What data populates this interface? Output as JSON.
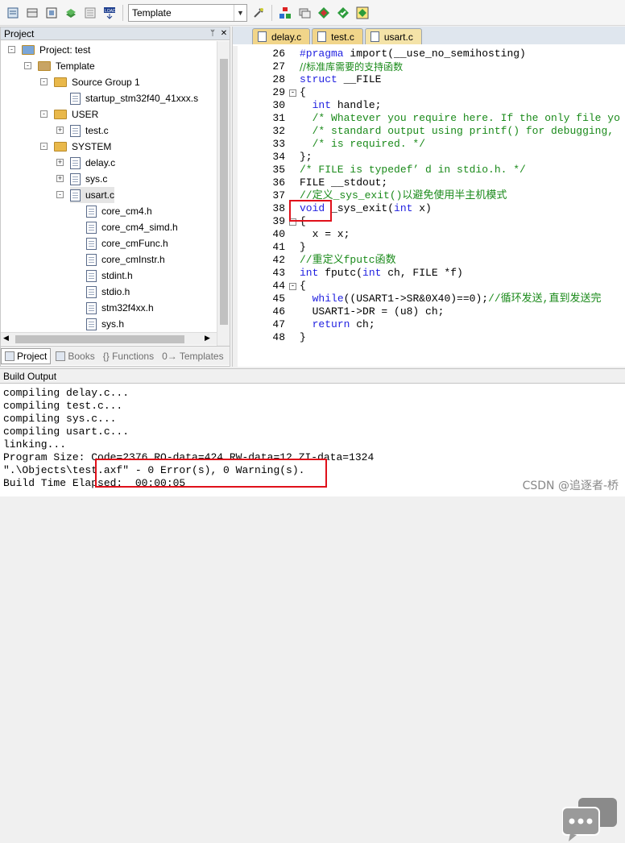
{
  "toolbar": {
    "target_name": "Template",
    "icons": [
      "settings-icon",
      "pack-icon",
      "build-icon",
      "books-icon",
      "download-icon",
      "load-icon",
      "options-icon",
      "run-icon",
      "debug-icon",
      "components-icon",
      "batch-icon",
      "manage-icon"
    ]
  },
  "project_panel": {
    "title": "Project",
    "pin": "p",
    "close": "x",
    "tree": [
      {
        "label": "Project: test",
        "level": 0,
        "kind": "project",
        "expander": "-"
      },
      {
        "label": "Template",
        "level": 1,
        "kind": "target",
        "expander": "-"
      },
      {
        "label": "Source Group 1",
        "level": 2,
        "kind": "folder",
        "expander": "-"
      },
      {
        "label": "startup_stm32f40_41xxx.s",
        "level": 3,
        "kind": "file",
        "expander": ""
      },
      {
        "label": "USER",
        "level": 2,
        "kind": "folder",
        "expander": "-"
      },
      {
        "label": "test.c",
        "level": 3,
        "kind": "file",
        "expander": "+"
      },
      {
        "label": "SYSTEM",
        "level": 2,
        "kind": "folder",
        "expander": "-"
      },
      {
        "label": "delay.c",
        "level": 3,
        "kind": "file",
        "expander": "+"
      },
      {
        "label": "sys.c",
        "level": 3,
        "kind": "file",
        "expander": "+"
      },
      {
        "label": "usart.c",
        "level": 3,
        "kind": "file",
        "expander": "-",
        "selected": true
      },
      {
        "label": "core_cm4.h",
        "level": 4,
        "kind": "file",
        "expander": ""
      },
      {
        "label": "core_cm4_simd.h",
        "level": 4,
        "kind": "file",
        "expander": ""
      },
      {
        "label": "core_cmFunc.h",
        "level": 4,
        "kind": "file",
        "expander": ""
      },
      {
        "label": "core_cmInstr.h",
        "level": 4,
        "kind": "file",
        "expander": ""
      },
      {
        "label": "stdint.h",
        "level": 4,
        "kind": "file",
        "expander": ""
      },
      {
        "label": "stdio.h",
        "level": 4,
        "kind": "file",
        "expander": ""
      },
      {
        "label": "stm32f4xx.h",
        "level": 4,
        "kind": "file",
        "expander": ""
      },
      {
        "label": "sys.h",
        "level": 4,
        "kind": "file",
        "expander": ""
      }
    ],
    "tabs": [
      {
        "label": "Project",
        "active": true
      },
      {
        "label": "Books",
        "active": false
      },
      {
        "label": "{} Functions",
        "active": false
      },
      {
        "label": "0→ Templates",
        "active": false
      }
    ]
  },
  "editor": {
    "tabs": [
      {
        "label": "delay.c",
        "active": false
      },
      {
        "label": "test.c",
        "active": false
      },
      {
        "label": "usart.c",
        "active": true
      }
    ],
    "lines": [
      {
        "n": "26",
        "fold": "",
        "html": "<span class='kw'>#pragma</span> import(__use_no_semihosting)"
      },
      {
        "n": "27",
        "fold": "",
        "html": "<span class='cm zh'>//标准库需要的支持函数</span>"
      },
      {
        "n": "28",
        "fold": "",
        "html": "<span class='kw'>struct</span> __FILE"
      },
      {
        "n": "29",
        "fold": "-",
        "html": "{"
      },
      {
        "n": "30",
        "fold": "",
        "html": "  <span class='kw'>int</span> handle;"
      },
      {
        "n": "31",
        "fold": "",
        "html": "  <span class='cm'>/* Whatever you require here. If the only file yo</span>"
      },
      {
        "n": "32",
        "fold": "",
        "html": "  <span class='cm'>/* standard output using printf() for debugging,</span>"
      },
      {
        "n": "33",
        "fold": "",
        "html": "  <span class='cm'>/* is required. */</span>"
      },
      {
        "n": "34",
        "fold": "",
        "html": "};"
      },
      {
        "n": "35",
        "fold": "",
        "html": "<span class='cm'>/* FILE is typedef’ d in stdio.h. */</span>"
      },
      {
        "n": "36",
        "fold": "",
        "html": "FILE __stdout;"
      },
      {
        "n": "37",
        "fold": "",
        "html": "<span class='cm'>//定义_sys_exit()以避免使用半主机模式</span>"
      },
      {
        "n": "38",
        "fold": "",
        "html": "<span class='kw'>void</span> _sys_exit(<span class='kw'>int</span> x)"
      },
      {
        "n": "39",
        "fold": "-",
        "html": "{"
      },
      {
        "n": "40",
        "fold": "",
        "html": "  x = x;"
      },
      {
        "n": "41",
        "fold": "",
        "html": "}"
      },
      {
        "n": "42",
        "fold": "",
        "html": "<span class='cm'>//重定义fputc函数</span>"
      },
      {
        "n": "43",
        "fold": "",
        "html": "<span class='kw'>int</span> fputc(<span class='kw'>int</span> ch, FILE *f)"
      },
      {
        "n": "44",
        "fold": "-",
        "html": "{"
      },
      {
        "n": "45",
        "fold": "",
        "html": "  <span class='kw'>while</span>((USART1->SR&amp;0X40)==0);<span class='cm'>//循环发送,直到发送完</span>"
      },
      {
        "n": "46",
        "fold": "",
        "html": "  USART1->DR = (u8) ch;"
      },
      {
        "n": "47",
        "fold": "",
        "html": "  <span class='kw'>return</span> ch;"
      },
      {
        "n": "48",
        "fold": "",
        "html": "}"
      }
    ]
  },
  "build_output": {
    "title": "Build Output",
    "lines": [
      "compiling delay.c...",
      "compiling test.c...",
      "compiling sys.c...",
      "compiling usart.c...",
      "linking...",
      "Program Size: Code=2376 RO-data=424 RW-data=12 ZI-data=1324",
      "\".\\Objects\\test.axf\" - 0 Error(s), 0 Warning(s).",
      "Build Time Elapsed:  00:00:05"
    ]
  },
  "watermark": "CSDN @追逐者-桥"
}
